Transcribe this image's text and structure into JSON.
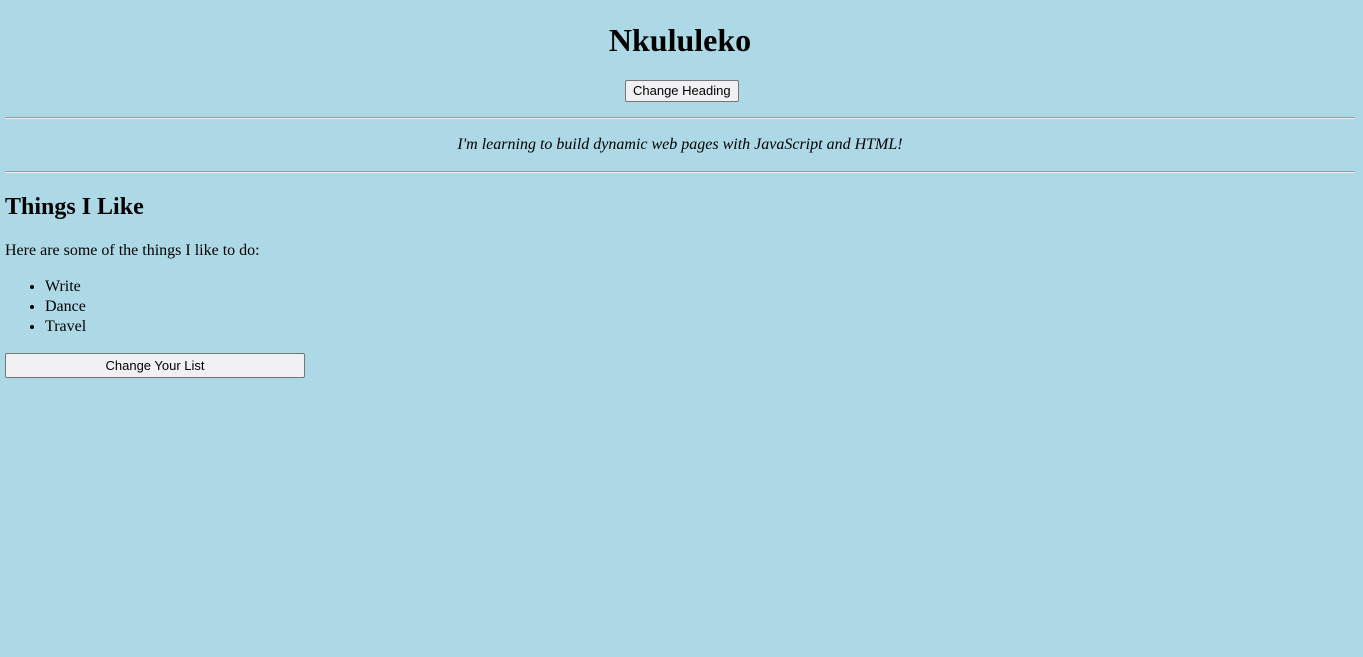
{
  "header": {
    "title": "Nkululeko",
    "change_heading_label": "Change Heading"
  },
  "tagline": "I'm learning to build dynamic web pages with JavaScript and HTML!",
  "likes": {
    "title": "Things I Like",
    "intro": "Here are some of the things I like to do:",
    "items": [
      "Write",
      "Dance",
      "Travel"
    ],
    "change_list_label": "Change Your List"
  },
  "colors": {
    "background": "#add8e6",
    "button_background": "#f1f1f4"
  }
}
